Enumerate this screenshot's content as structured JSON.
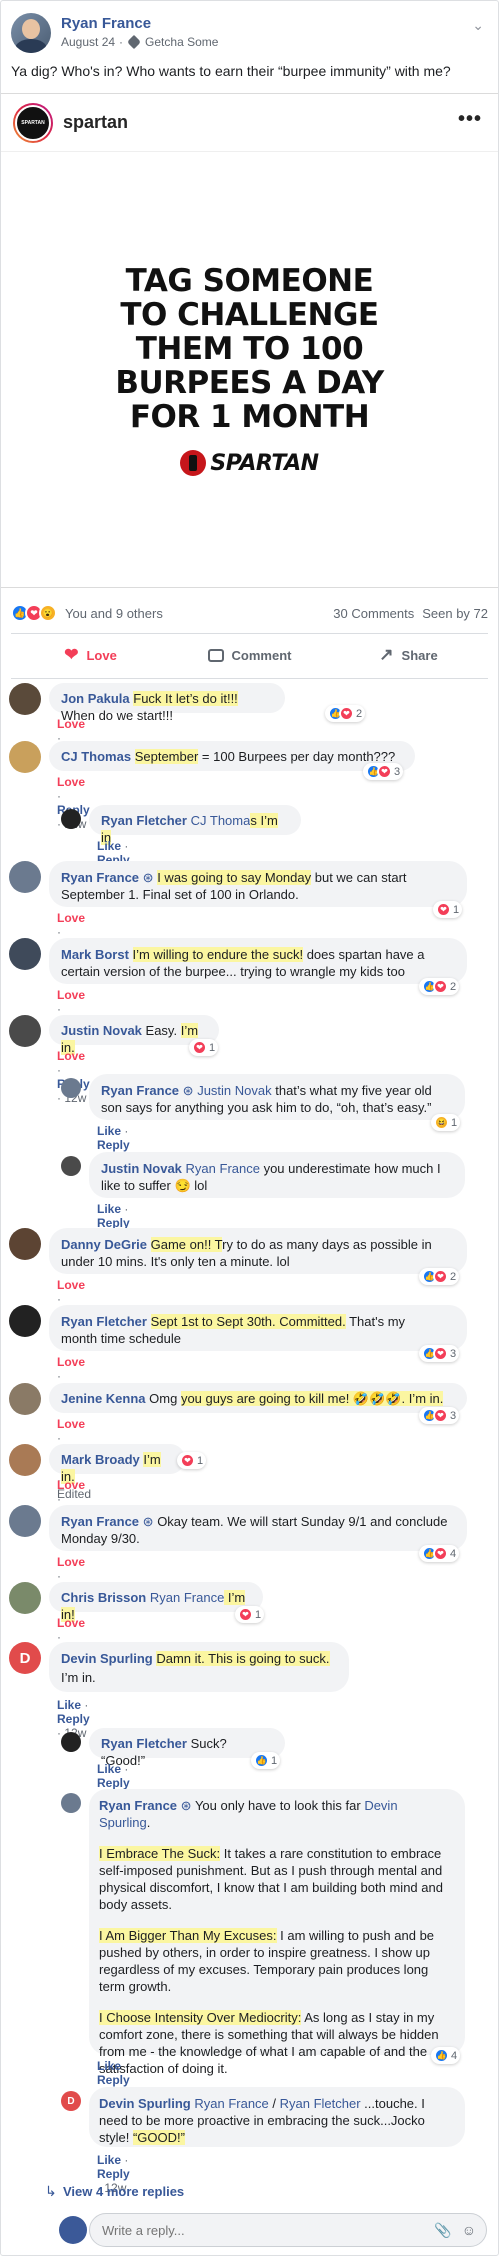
{
  "post": {
    "author": "Ryan France",
    "date": "August 24",
    "group": "Getcha Some",
    "text": "Ya dig? Who's in? Who wants to earn their “burpee immunity” with me?"
  },
  "embed": {
    "account": "spartan",
    "title_lines": [
      "TAG SOMEONE",
      "TO CHALLENGE",
      "THEM TO 100",
      "BURPEES A DAY",
      "FOR 1 MONTH"
    ],
    "brand": "SPARTAN",
    "logo_text": "SPARTAN"
  },
  "reactions": {
    "summary": "You and 9 others",
    "comments": "30 Comments",
    "seen": "Seen by 72"
  },
  "actions": {
    "love": "Love",
    "comment": "Comment",
    "share": "Share"
  },
  "labels": {
    "love": "Love",
    "like": "Like",
    "reply": "Reply",
    "dot": "·"
  },
  "comments": [
    {
      "name": "Jon Pakula",
      "hl": "Fuck It let’s do it!!!",
      "text": " When do we start!!!",
      "age": "12w",
      "count": "2"
    },
    {
      "name": "CJ Thomas",
      "hl": "September",
      "text": " = 100 Burpees per day month???",
      "age": "12w",
      "count": "3"
    },
    {
      "name": "Ryan Fletcher",
      "mention": "CJ Thoma",
      "hl": "s I’m in",
      "age": "12w"
    },
    {
      "name": "Ryan France",
      "hl": "I was going to say Monday",
      "text": " but we can start",
      "text2": "September 1. Final set of 100 in Orlando.",
      "age": "12w",
      "count": "1"
    },
    {
      "name": "Mark Borst",
      "hl": "I’m willing to endure the suck!",
      "text": " does spartan have a",
      "text2": "certain version of the burpee... trying to wrangle my kids too",
      "age": "12w",
      "count": "2"
    },
    {
      "name": "Justin Novak",
      "text": " Easy. ",
      "hl": "I’m in.",
      "age": "12w",
      "count": "1"
    },
    {
      "name": "Ryan France",
      "mention": "Justin Novak",
      "text": " that’s what my five year old",
      "text2": "son says for anything you ask him to do, “oh, that’s easy.”",
      "age": "12w",
      "count": "1"
    },
    {
      "name": "Justin Novak",
      "mention": "Ryan France",
      "text": " you underestimate how much I",
      "text2": "like to suffer 😏 lol",
      "age": "12w"
    },
    {
      "name": "Danny DeGrie",
      "hl": "Game on!! T",
      "text": "ry to do as many days as possible in",
      "text2": "under 10 mins. It's only ten a minute. lol",
      "age": "12w",
      "count": "2"
    },
    {
      "name": "Ryan Fletcher",
      "hl": "Sept 1st to Sept 30th. Committed.",
      "text": " That's my",
      "text2": "month time schedule",
      "age": "12w",
      "count": "3"
    },
    {
      "name": "Jenine Kenna",
      "text": " Omg ",
      "hl": "you guys are going to kill me! 🤣🤣🤣. I’m in.",
      "age": "12w",
      "edited": "Edited",
      "count": "3"
    },
    {
      "name": "Mark Broady",
      "hl": "I’m in.",
      "age": "12w",
      "count": "1"
    },
    {
      "name": "Ryan France",
      "text": " Okay team. We will start Sunday 9/1 and conclude",
      "text2": "Monday 9/30.",
      "age": "12w",
      "count": "4"
    },
    {
      "name": "Chris Brisson",
      "mention": "Ryan France",
      "hl": " I’m in!",
      "age": "12w",
      "count": "1"
    },
    {
      "name": "Devin Spurling",
      "hl": "Damn it. This is going to suck.",
      "text2": "I’m in.",
      "age": "12w"
    },
    {
      "name": "Ryan Fletcher",
      "text": " Suck? “Good!”",
      "age": "12w",
      "count": "1"
    },
    {
      "name": "Ryan France",
      "text": " You only have to look this far ",
      "mention": "Devin",
      "mention2": "Spurling",
      "age": "12w",
      "count": "4",
      "p1_hl": "I Embrace The Suck:",
      "p1": " It takes a rare constitution to embrace self-imposed punishment. But as I push through mental and physical discomfort, I know that I am building both mind and body assets.",
      "p2_hl": "I Am Bigger Than My Excuses:",
      "p2": " I am willing to push and be pushed by others, in order to inspire greatness. I show up regardless of my excuses. Temporary pain produces long term growth.",
      "p3_hl": "I Choose Intensity Over Mediocrity:",
      "p3": " As long as I stay in my comfort zone, there is something that will always be hidden from me - the knowledge of what I am capable of and the satisfaction of doing it."
    },
    {
      "name": "Devin Spurling",
      "mention": "Ryan France",
      "sep": " / ",
      "mention2": "Ryan Fletcher",
      "text": " ...touche. I",
      "text2": "need to be more proactive in embracing the suck...Jocko",
      "text3": "style! ",
      "hl": "“GOOD!”",
      "age": "12w"
    }
  ],
  "view_more": "View 4 more replies",
  "reply_placeholder": "Write a reply..."
}
